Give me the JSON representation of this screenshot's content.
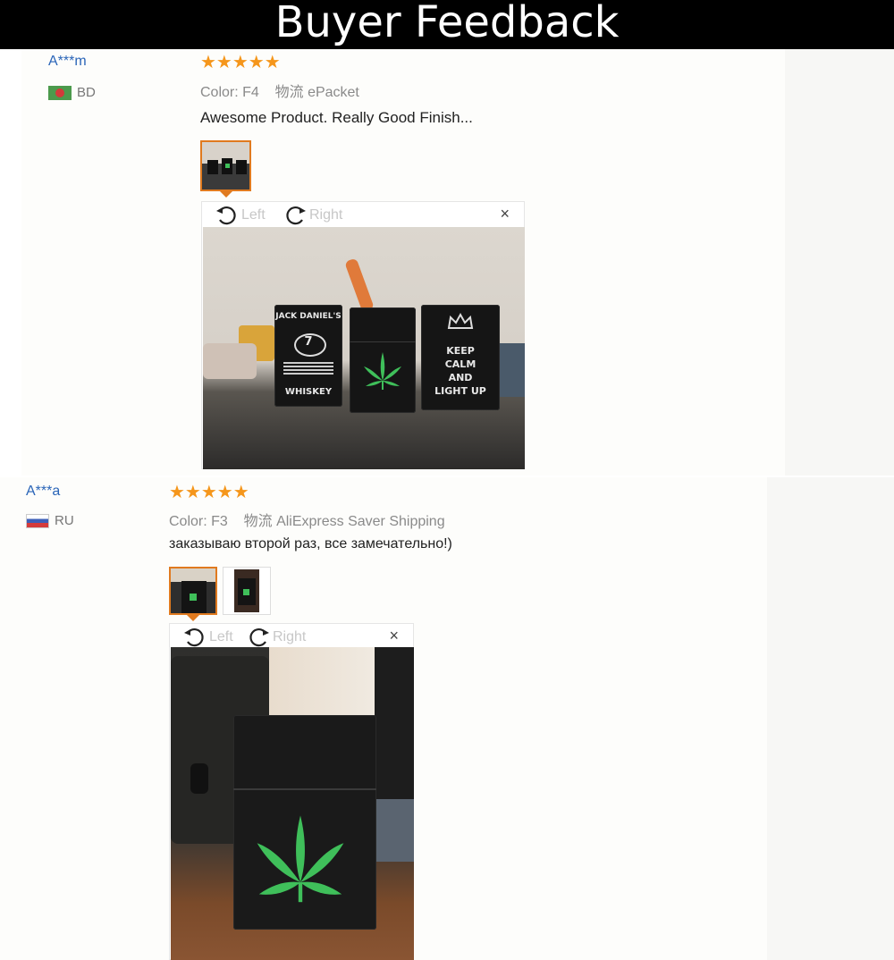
{
  "banner": {
    "title": "Buyer Feedback"
  },
  "reviews": [
    {
      "user": "A***m",
      "country": "BD",
      "stars": "★★★★★",
      "color_label": "Color:",
      "color_value": "F4",
      "shipping_label": "物流",
      "shipping_value": "ePacket",
      "comment": "Awesome Product. Really Good Finish...",
      "viewer": {
        "left_label": "Left",
        "right_label": "Right",
        "close": "×"
      },
      "photo_text": {
        "box1_top": "JACK DANIEL'S",
        "box1_mid": "7",
        "box1_bottom": "WHISKEY",
        "box3": "KEEP CALM AND LIGHT UP"
      }
    },
    {
      "user": "A***a",
      "country": "RU",
      "stars": "★★★★★",
      "color_label": "Color:",
      "color_value": "F3",
      "shipping_label": "物流",
      "shipping_value": "AliExpress Saver Shipping",
      "comment": "заказываю второй раз, все замечательно!)",
      "viewer": {
        "left_label": "Left",
        "right_label": "Right",
        "close": "×"
      }
    }
  ],
  "colors": {
    "star": "#f5961b",
    "username": "#2a65b8",
    "active_thumb": "#e07a1f",
    "leaf": "#3fbf5a"
  }
}
